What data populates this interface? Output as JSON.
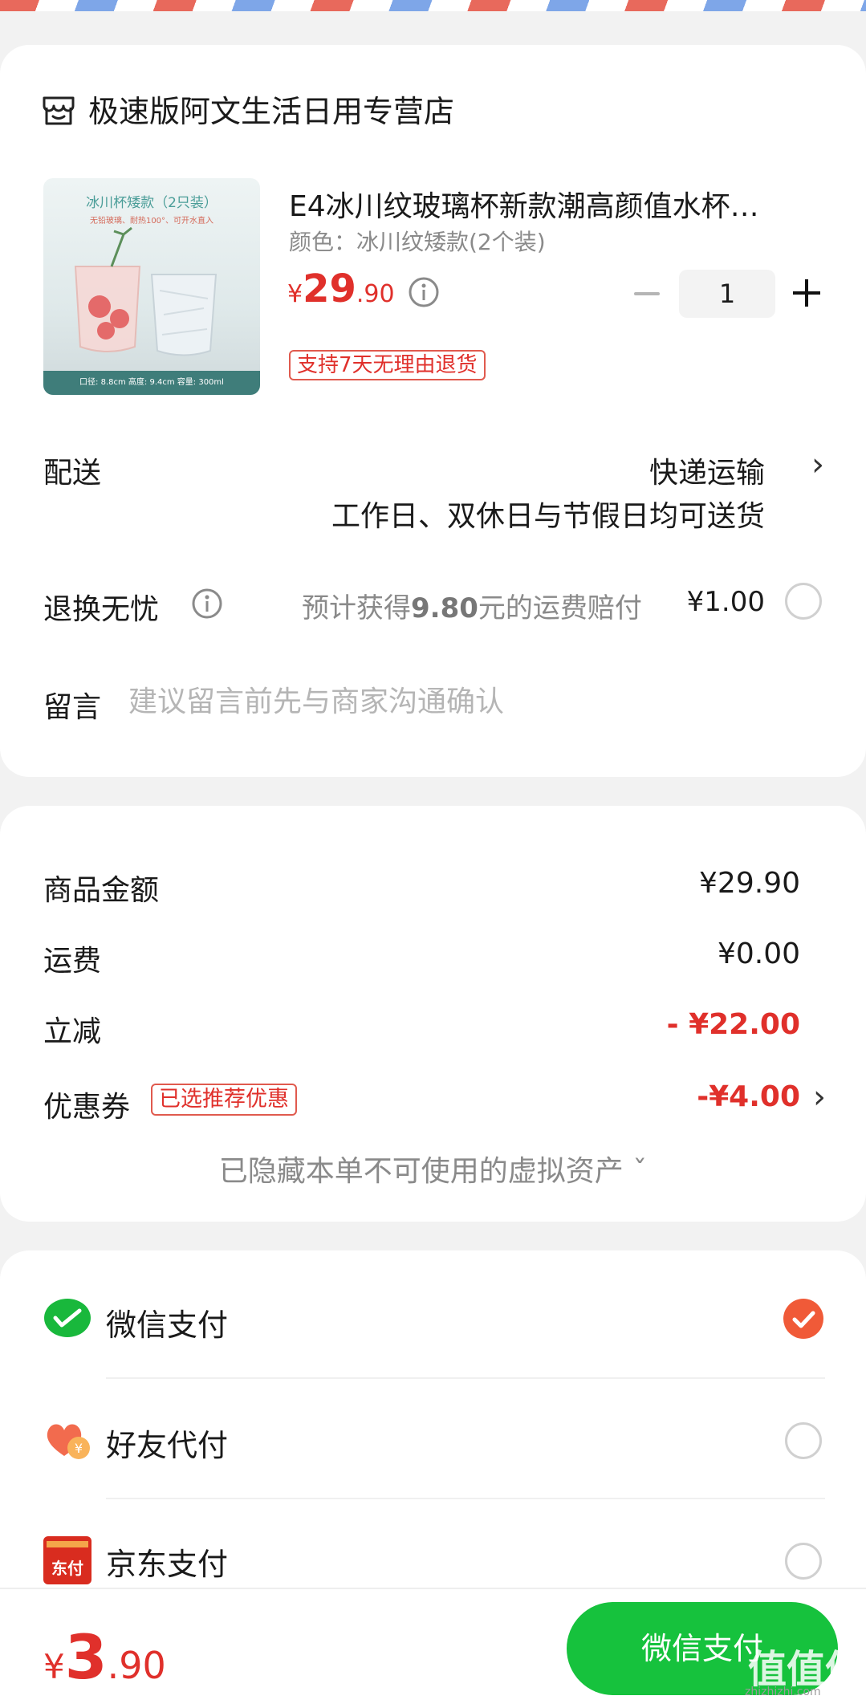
{
  "shop": {
    "name": "极速版阿文生活日用专营店",
    "icon": "shop-icon"
  },
  "product": {
    "image": {
      "title": "冰川杯矮款（2只装）",
      "subtitle": "无铅玻璃、耐热100°、可开水直入",
      "footer": "口径: 8.8cm    高度: 9.4cm    容量: 300ml"
    },
    "title": "E4冰川纹玻璃杯新款潮高颜值水杯…",
    "variant": "颜色：冰川纹矮款(2个装)",
    "price": {
      "currency": "¥",
      "integer": "29",
      "decimal": ".90"
    },
    "quantity": "1",
    "return_tag": "支持7天无理由退货"
  },
  "delivery": {
    "label": "配送",
    "method": "快递运输",
    "note": "工作日、双休日与节假日均可送货"
  },
  "refund": {
    "label": "退换无忧",
    "desc_prefix": "预计获得",
    "desc_amount": "9.80",
    "desc_suffix": "元的运费赔付",
    "price": "¥1.00"
  },
  "message": {
    "label": "留言",
    "placeholder": "建议留言前先与商家沟通确认"
  },
  "summary": {
    "goods_label": "商品金额",
    "goods_value": "¥29.90",
    "shipping_label": "运费",
    "shipping_value": "¥0.00",
    "discount_label": "立减",
    "discount_value": "- ¥22.00",
    "coupon_label": "优惠券",
    "coupon_tag": "已选推荐优惠",
    "coupon_value": "-¥4.00",
    "hidden_assets": "已隐藏本单不可使用的虚拟资产 ˇ"
  },
  "payment": {
    "methods": [
      {
        "label": "微信支付",
        "icon": "wechat-pay-icon",
        "selected": true
      },
      {
        "label": "好友代付",
        "icon": "friend-pay-icon",
        "selected": false
      },
      {
        "label": "京东支付",
        "icon": "jd-pay-icon",
        "selected": false
      }
    ],
    "jd_icon_text": "东付"
  },
  "footer": {
    "total": {
      "currency": "¥",
      "integer": "3",
      "decimal": ".90"
    },
    "pay_button": "微信支付",
    "watermark": "值值值",
    "watermark_url": "zhizhizhi.com"
  },
  "colors": {
    "accent_red": "#e0302b",
    "wechat_green": "#16c23d",
    "check_orange": "#f05a38"
  }
}
